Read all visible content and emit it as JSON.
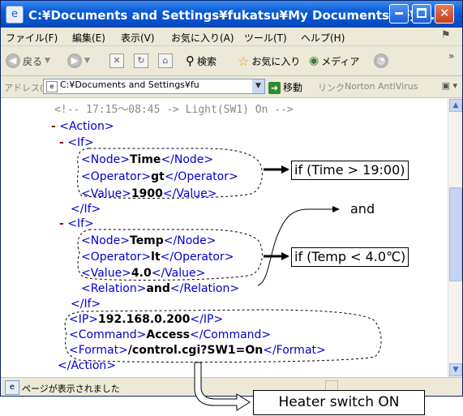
{
  "window": {
    "title": "C:¥Documents and Settings¥fukatsu¥My Documents¥研究¥...",
    "minimize_label": "_",
    "maximize_label": "□",
    "close_label": "✕"
  },
  "menu": [
    "ファイル(F)",
    "編集(E)",
    "表示(V)",
    "お気に入り(A)",
    "ツール(T)",
    "ヘルプ(H)"
  ],
  "toolbar": {
    "back_label": "戻る",
    "search_label": "検索",
    "favorites_label": "お気に入り",
    "media_label": "メディア",
    "chevron": "»"
  },
  "address": {
    "label": "アドレス(D)",
    "value": "C:¥Documents and Settings¥fu",
    "go_label": "移動",
    "links_label": "リンク",
    "norton_label": "Norton AntiVirus"
  },
  "xml": {
    "comment": "<!-- 17:15～08:45 -> Light(SW1) On -->",
    "action_open": "<Action>",
    "if_open": "<If>",
    "if_close": "</If>",
    "node_open": "<Node>",
    "node_close": "</Node>",
    "operator_open": "<Operator>",
    "operator_close": "</Operator>",
    "value_open": "<Value>",
    "value_close": "</Value>",
    "relation_open": "<Relation>",
    "relation_close": "</Relation>",
    "ip_open": "<IP>",
    "ip_close": "</IP>",
    "command_open": "<Command>",
    "command_close": "</Command>",
    "format_open": "<Format>",
    "format_close": "</Format>",
    "action_close": "</Action>",
    "minus": "-",
    "if1": {
      "node": "Time",
      "operator": "gt",
      "value": "1900"
    },
    "if2": {
      "node": "Temp",
      "operator": "lt",
      "value": "4.0",
      "relation": "and"
    },
    "ip": "192.168.0.200",
    "command": "Access",
    "format": "/control.cgi?SW1=On"
  },
  "annotations": {
    "cond1": "if (Time > 19:00)",
    "cond2": "if (Temp < 4.0℃)",
    "and": "and",
    "result": "Heater switch ON"
  },
  "status": {
    "text": "ページが表示されました"
  }
}
